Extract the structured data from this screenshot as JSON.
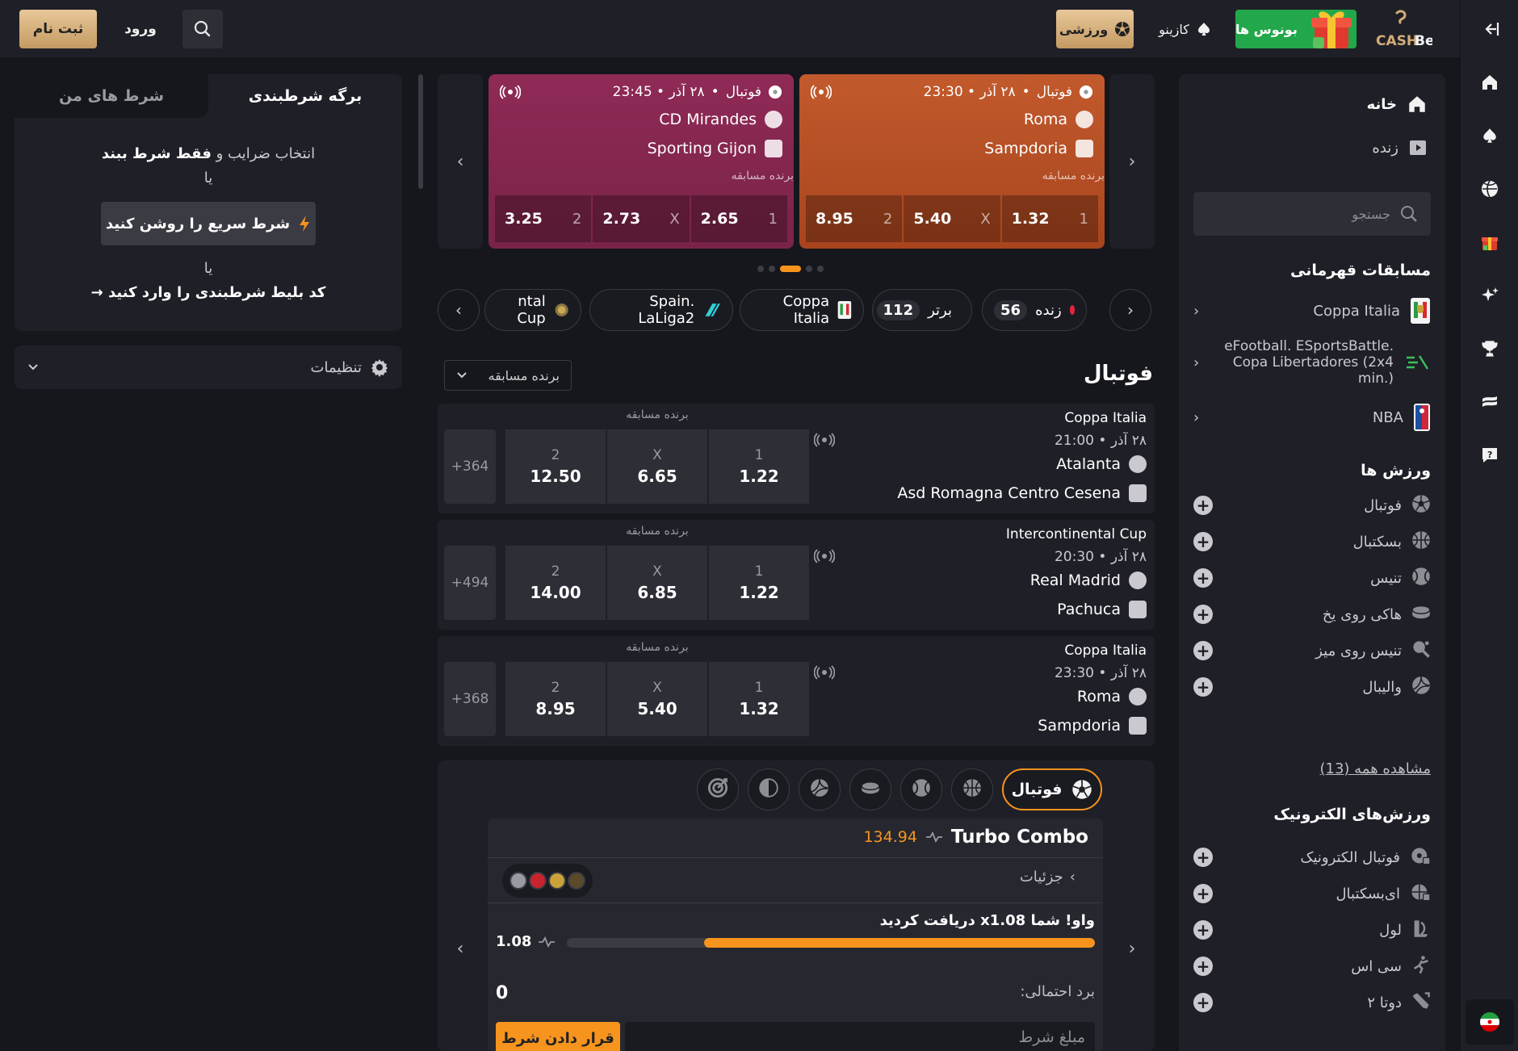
{
  "header": {
    "register": "ثبت نام",
    "login": "ورود",
    "nav_sport": "ورزشی",
    "nav_casino": "کازینو",
    "nav_bonus": "بونوس ها",
    "logo_text": "CASHBet"
  },
  "sidebar": {
    "home": "خانه",
    "live": "زنده",
    "search_placeholder": "جستجو",
    "tournaments_title": "مسابقات قهرمانی",
    "tournaments": [
      {
        "label": "Coppa Italia"
      },
      {
        "label": "eFootball. ESportsBattle. Copa Libertadores (2x4 min.)"
      },
      {
        "label": "NBA"
      }
    ],
    "sports_title": "ورزش ها",
    "sports": [
      {
        "label": "فوتبال",
        "icon": "soccer-ball-icon"
      },
      {
        "label": "بسکتبال",
        "icon": "basketball-icon"
      },
      {
        "label": "تنیس",
        "icon": "tennis-ball-icon"
      },
      {
        "label": "هاکی روی یخ",
        "icon": "hockey-puck-icon"
      },
      {
        "label": "تنیس روی میز",
        "icon": "ping-pong-icon"
      },
      {
        "label": "والیبال",
        "icon": "volleyball-icon"
      }
    ],
    "view_all": "مشاهده همه (13)",
    "esports_title": "ورزش‌های الکترونیک",
    "esports": [
      {
        "label": "فوتبال الکترونیک",
        "icon": "esoccer-icon"
      },
      {
        "label": "ای‌بسکتبال",
        "icon": "ebasketball-icon"
      },
      {
        "label": "لول",
        "icon": "lol-icon"
      },
      {
        "label": "سی اس",
        "icon": "cs-icon"
      },
      {
        "label": "دوتا ۲",
        "icon": "dota-icon"
      }
    ]
  },
  "featured": [
    {
      "sport": "فوتبال",
      "datetime": "۲۸ آذر • 23:30",
      "team1": "Roma",
      "team2": "Sampdoria",
      "market": "برنده مسابقه",
      "odds": [
        {
          "k": "1",
          "v": "1.32"
        },
        {
          "k": "X",
          "v": "5.40"
        },
        {
          "k": "2",
          "v": "8.95"
        }
      ],
      "color": "#c0522a"
    },
    {
      "sport": "فوتبال",
      "datetime": "۲۸ آذر • 23:45",
      "team1": "CD Mirandes",
      "team2": "Sporting Gijon",
      "market": "برنده مسابقه",
      "odds": [
        {
          "k": "1",
          "v": "2.65"
        },
        {
          "k": "X",
          "v": "2.73"
        },
        {
          "k": "2",
          "v": "3.25"
        }
      ],
      "color": "#8e2a52"
    }
  ],
  "carousel": {
    "active_index": 2,
    "count": 5
  },
  "chips": {
    "live_label": "زنده",
    "live_count": "56",
    "top_label": "برتر",
    "top_count": "112",
    "c1": "Coppa Italia",
    "c2": "Spain. LaLiga2",
    "c3": "ntal Cup"
  },
  "section": {
    "title": "فوتبال",
    "market_select": "برنده مسابقه"
  },
  "matches": [
    {
      "league": "Coppa Italia",
      "datetime": "۲۸ آذر • 21:00",
      "team1": "Atalanta",
      "team2": "Asd Romagna Centro Cesena",
      "market": "برنده مسابقه",
      "odds": [
        {
          "k": "1",
          "v": "1.22"
        },
        {
          "k": "X",
          "v": "6.65"
        },
        {
          "k": "2",
          "v": "12.50"
        }
      ],
      "more": "364+"
    },
    {
      "league": "Intercontinental Cup",
      "datetime": "۲۸ آذر • 20:30",
      "team1": "Real Madrid",
      "team2": "Pachuca",
      "market": "برنده مسابقه",
      "odds": [
        {
          "k": "1",
          "v": "1.22"
        },
        {
          "k": "X",
          "v": "6.85"
        },
        {
          "k": "2",
          "v": "14.00"
        }
      ],
      "more": "494+"
    },
    {
      "league": "Coppa Italia",
      "datetime": "۲۸ آذر • 23:30",
      "team1": "Roma",
      "team2": "Sampdoria",
      "market": "برنده مسابقه",
      "odds": [
        {
          "k": "1",
          "v": "1.32"
        },
        {
          "k": "X",
          "v": "5.40"
        },
        {
          "k": "2",
          "v": "8.95"
        }
      ],
      "more": "368+"
    }
  ],
  "turbo": {
    "tab_label": "فوتبال",
    "title": "Turbo Combo",
    "total": "134.94",
    "details": "جزئیات",
    "wow": "واو! شما x1.08 دریافت کردید",
    "multiplier": "1.08",
    "progress": 0.74,
    "potential_label": "برد احتمالی:",
    "potential_value": "0",
    "stake_placeholder": "مبلغ شرط",
    "place_bet": "قرار دادن شرط"
  },
  "betslip": {
    "tab_active": "برگه شرطبندی",
    "tab_other": "شرط های من",
    "pick_text": "انتخاب ضرایب و",
    "pick_bold": "فقط شرط ببند",
    "or1": "یا",
    "quick_bet": "شرط سریع را روشن کنید",
    "or2": "یا",
    "code": "کد بلیط شرطبندی را وارد کنید →",
    "settings": "تنظیمات"
  },
  "colors": {
    "accent": "#f7941d",
    "gold": "#d4ad78",
    "bonus_green": "#22a84a",
    "bg": "#16171c",
    "panel": "#1f2027"
  }
}
